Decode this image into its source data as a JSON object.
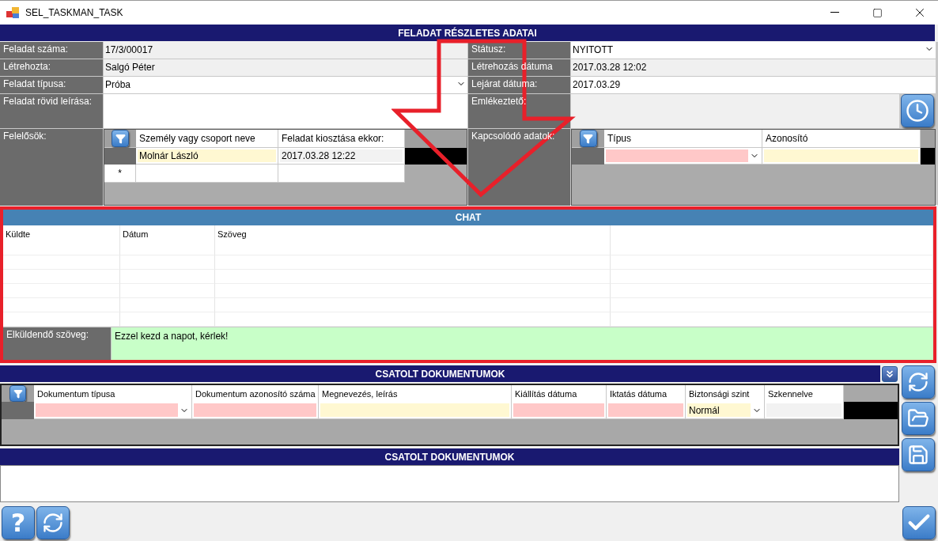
{
  "window": {
    "title": "SEL_TASKMAN_TASK"
  },
  "details": {
    "title": "FELADAT RÉSZLETES ADATAI",
    "left_fields": [
      {
        "label": "Feladat száma:",
        "value": "17/3/00017",
        "kind": "readonly"
      },
      {
        "label": "Létrehozta:",
        "value": "Salgó Péter",
        "kind": "readonly"
      },
      {
        "label": "Feladat típusa:",
        "value": "Próba",
        "kind": "dropdown"
      },
      {
        "label": "Feladat rövid leírása:",
        "kind": "memo"
      }
    ],
    "right_fields": [
      {
        "label": "Státusz:",
        "value": "NYITOTT",
        "kind": "dropdown"
      },
      {
        "label": "Létrehozás dátuma",
        "value": "2017.03.28 12:02",
        "kind": "readonly"
      },
      {
        "label": "Lejárat dátuma:",
        "value": "2017.03.29",
        "kind": "input"
      },
      {
        "label": "Emlékeztető:",
        "kind": "timer"
      }
    ],
    "responsible": {
      "label": "Felelősök:",
      "columns": [
        "Személy vagy csoport neve",
        "Feladat kiosztása ekkor:"
      ],
      "rows": [
        {
          "cells": [
            {
              "value": "Molnár László",
              "kind": "optional",
              "dropdown": false
            },
            {
              "value": "2017.03.28 12:22",
              "kind": "readonly",
              "dropdown": false
            }
          ]
        }
      ],
      "new_row_marker": "*"
    },
    "related": {
      "label": "Kapcsolódó adatok:",
      "columns": [
        "Típus",
        "Azonosító"
      ],
      "rows": [
        {
          "cells": [
            {
              "kind": "required",
              "dropdown": true
            },
            {
              "kind": "optional",
              "dropdown": false
            }
          ]
        }
      ]
    }
  },
  "chat": {
    "title": "CHAT",
    "columns": [
      "Küldte",
      "Dátum",
      "Szöveg"
    ],
    "message": {
      "label": "Elküldendő szöveg:",
      "value": "Ezzel kezd a napot, kérlek!"
    }
  },
  "documents": {
    "title": "CSATOLT DOKUMENTUMOK",
    "columns": [
      "Dokumentum típusa",
      "Dokumentum azonosító száma",
      "Megnevezés, leírás",
      "Kiállítás dátuma",
      "Iktatás dátuma",
      "Biztonsági szint",
      "Szkennelve"
    ],
    "rows": [
      {
        "cells": [
          {
            "kind": "required",
            "dropdown": true
          },
          {
            "kind": "required",
            "dropdown": false
          },
          {
            "kind": "optional",
            "dropdown": false
          },
          {
            "kind": "required",
            "dropdown": false
          },
          {
            "kind": "required",
            "dropdown": false
          },
          {
            "value": "Normál",
            "kind": "optional",
            "dropdown": true
          },
          {
            "kind": "readonly",
            "dropdown": false
          }
        ]
      }
    ]
  },
  "documents_2": {
    "title": "CSATOLT DOKUMENTUMOK"
  },
  "help_button": {
    "label": "?"
  }
}
